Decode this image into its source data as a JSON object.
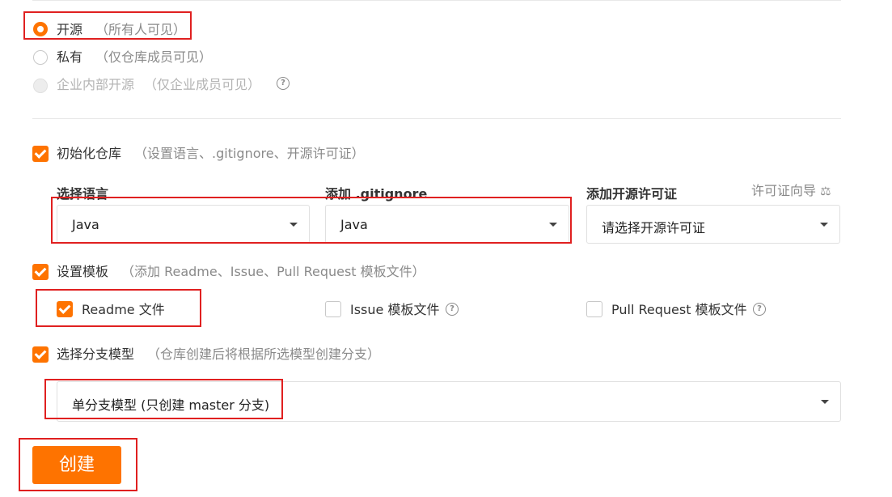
{
  "visibility": {
    "public": {
      "label": "开源",
      "hint": "（所有人可见）",
      "selected": true
    },
    "private": {
      "label": "私有",
      "hint": "（仅仓库成员可见）",
      "selected": false
    },
    "internal": {
      "label": "企业内部开源",
      "hint": "（仅企业成员可见）",
      "disabled": true,
      "help_icon": "question-circle-icon"
    }
  },
  "init_repo": {
    "checked": true,
    "label": "初始化仓库",
    "hint": "（设置语言、.gitignore、开源许可证）",
    "language": {
      "label": "选择语言",
      "value": "Java"
    },
    "gitignore": {
      "label": "添加 .gitignore",
      "value": "Java"
    },
    "license": {
      "label": "添加开源许可证",
      "placeholder": "请选择开源许可证",
      "guide_label": "许可证向导",
      "guide_icon": "scale-icon"
    }
  },
  "templates": {
    "checked": true,
    "label": "设置模板",
    "hint": "（添加 Readme、Issue、Pull Request 模板文件）",
    "items": [
      {
        "label": "Readme 文件",
        "checked": true
      },
      {
        "label": "Issue 模板文件",
        "checked": false,
        "help_icon": "question-circle-icon"
      },
      {
        "label": "Pull Request 模板文件",
        "checked": false,
        "help_icon": "question-circle-icon"
      }
    ]
  },
  "branch_model": {
    "checked": true,
    "label": "选择分支模型",
    "hint": "（仓库创建后将根据所选模型创建分支）",
    "value": "单分支模型 (只创建 master 分支)"
  },
  "create_button": {
    "label": "创建"
  },
  "colors": {
    "accent": "#fe7300",
    "highlight_box": "#e02020"
  }
}
